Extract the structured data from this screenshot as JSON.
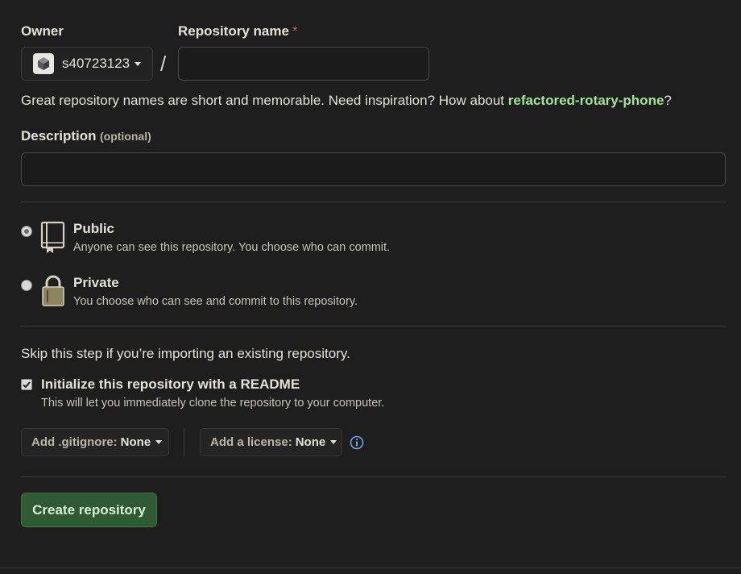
{
  "owner": {
    "label": "Owner",
    "name": "s40723123"
  },
  "repo": {
    "label": "Repository name",
    "required_mark": "*",
    "value": ""
  },
  "separator": "/",
  "hint": {
    "prefix": "Great repository names are short and memorable. Need inspiration? How about ",
    "suggestion": "refactored-rotary-phone",
    "suffix": "?"
  },
  "description": {
    "label": "Description",
    "optional": "(optional)",
    "value": ""
  },
  "visibility": {
    "public": {
      "title": "Public",
      "desc": "Anyone can see this repository. You choose who can commit.",
      "checked": true
    },
    "private": {
      "title": "Private",
      "desc": "You choose who can see and commit to this repository.",
      "checked": false
    }
  },
  "skip_text": "Skip this step if you’re importing an existing repository.",
  "readme": {
    "title": "Initialize this repository with a README",
    "desc": "This will let you immediately clone the repository to your computer.",
    "checked": true
  },
  "gitignore": {
    "label": "Add .gitignore:",
    "value": "None"
  },
  "license": {
    "label": "Add a license:",
    "value": "None"
  },
  "create_button": "Create repository",
  "colors": {
    "accent_green": "#a3e29a",
    "button_bg": "#2f5a34",
    "info_blue": "#6aa9e6"
  },
  "icons": [
    "caret-down-icon",
    "repo-book-icon",
    "lock-icon",
    "info-icon",
    "checkbox-icon"
  ]
}
